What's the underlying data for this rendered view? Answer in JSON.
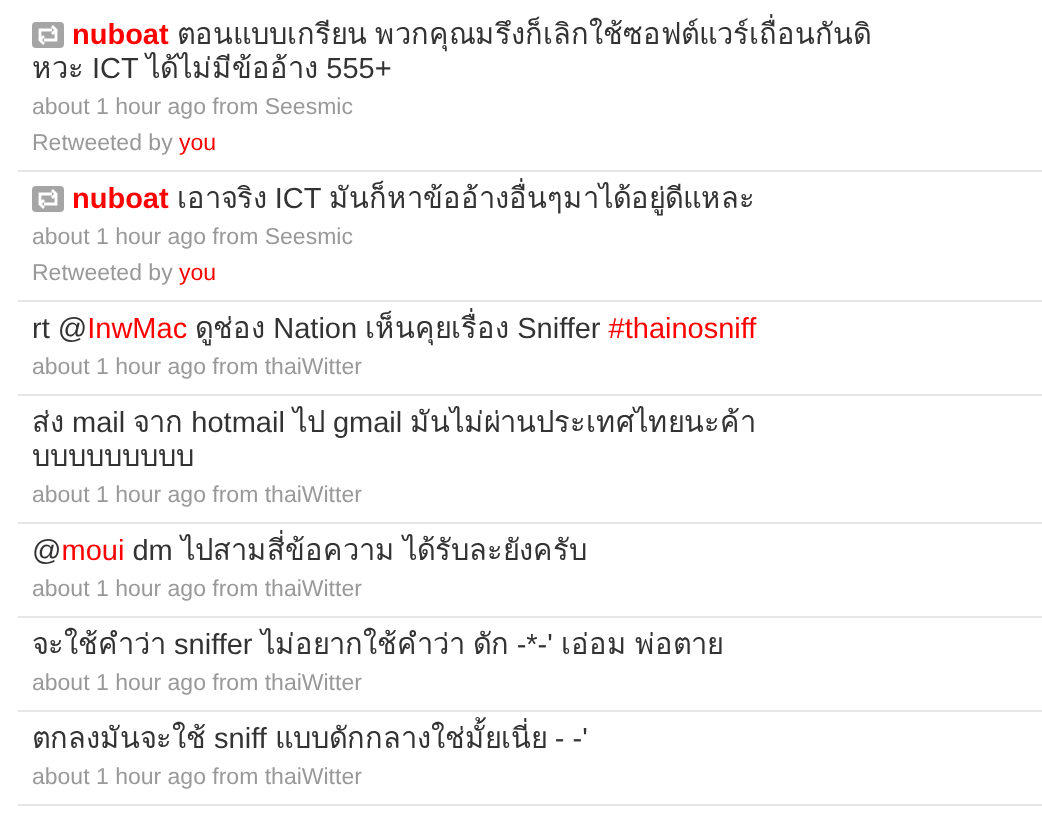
{
  "tweets": [
    {
      "kind": "retweet",
      "user": "nuboat",
      "segments": [
        {
          "kind": "plain",
          "text": "ตอนแบบเกรียน พวกคุณมรึงก็เลิกใช้ซอฟต์แวร์เถื่อนกันดิหวะ ICT ได้ไม่มีข้ออ้าง 555+"
        }
      ],
      "meta": "about 1 hour ago from Seesmic",
      "retweeted_label": "Retweeted by",
      "retweeted_by": "you"
    },
    {
      "kind": "retweet",
      "user": "nuboat",
      "segments": [
        {
          "kind": "plain",
          "text": "เอาจริง ICT มันก็หาข้ออ้างอื่นๆมาได้อยู่ดีแหละ"
        }
      ],
      "meta": "about 1 hour ago from Seesmic",
      "retweeted_label": "Retweeted by",
      "retweeted_by": "you"
    },
    {
      "kind": "tweet",
      "segments": [
        {
          "kind": "plain",
          "text": "rt @"
        },
        {
          "kind": "link",
          "text": "InwMac"
        },
        {
          "kind": "plain",
          "text": " ดูช่อง Nation เห็นคุยเรื่อง Sniffer "
        },
        {
          "kind": "link",
          "text": "#thainosniff"
        }
      ],
      "meta": "about 1 hour ago from thaiWitter"
    },
    {
      "kind": "tweet",
      "segments": [
        {
          "kind": "plain",
          "text": "ส่ง mail จาก hotmail ไป gmail มันไม่ผ่านประเทศไทยนะค้าบบบบบบบบบ"
        }
      ],
      "meta": "about 1 hour ago from thaiWitter"
    },
    {
      "kind": "tweet",
      "segments": [
        {
          "kind": "plain",
          "text": "@"
        },
        {
          "kind": "link",
          "text": "moui"
        },
        {
          "kind": "plain",
          "text": " dm ไปสามสี่ข้อความ ได้รับละยังครับ"
        }
      ],
      "meta": "about 1 hour ago from thaiWitter"
    },
    {
      "kind": "tweet",
      "segments": [
        {
          "kind": "plain",
          "text": "จะใช้คำว่า sniffer ไม่อยากใช้คำว่า ดัก -*-' เอ่อม พ่อตาย"
        }
      ],
      "meta": "about 1 hour ago from thaiWitter"
    },
    {
      "kind": "tweet",
      "segments": [
        {
          "kind": "plain",
          "text": "ตกลงมันจะใช้ sniff แบบดักกลางใช่มั้ยเนี่ย - -'"
        }
      ],
      "meta": "about 1 hour ago from thaiWitter"
    }
  ]
}
